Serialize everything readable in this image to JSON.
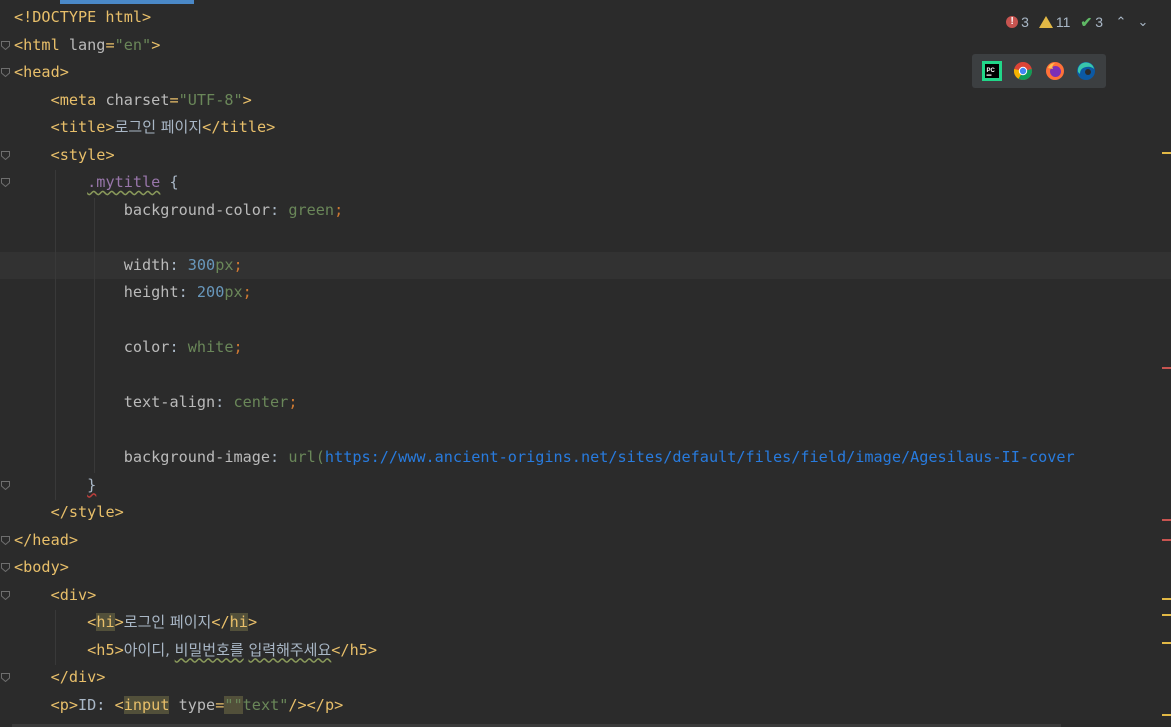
{
  "editor": {
    "lines": [
      {
        "segments": [
          [
            "tag",
            "<!DOCTYPE html>"
          ]
        ],
        "fold": false
      },
      {
        "segments": [
          [
            "tag",
            "<html "
          ],
          [
            "attr",
            "lang"
          ],
          [
            "tag",
            "="
          ],
          [
            "str",
            "\"en\""
          ],
          [
            "tag",
            ">"
          ]
        ],
        "fold": true
      },
      {
        "segments": [
          [
            "tag",
            "<head>"
          ]
        ],
        "fold": true
      },
      {
        "segments": [
          [
            "pl",
            "    "
          ],
          [
            "tag",
            "<meta "
          ],
          [
            "attr",
            "charset"
          ],
          [
            "tag",
            "="
          ],
          [
            "str",
            "\"UTF-8\""
          ],
          [
            "tag",
            ">"
          ]
        ],
        "fold": false
      },
      {
        "segments": [
          [
            "pl",
            "    "
          ],
          [
            "tag",
            "<title>"
          ],
          [
            "kr",
            "로그인 페이지"
          ],
          [
            "tag",
            "</title>"
          ]
        ],
        "fold": false
      },
      {
        "segments": [
          [
            "pl",
            "    "
          ],
          [
            "tag",
            "<style>"
          ]
        ],
        "fold": true
      },
      {
        "segments": [
          [
            "pl",
            "        "
          ],
          [
            "sel-squig",
            ".mytitle"
          ],
          [
            "pl",
            " {"
          ]
        ],
        "fold": true
      },
      {
        "segments": [
          [
            "pl",
            "            "
          ],
          [
            "prop",
            "background-color"
          ],
          [
            "pl",
            ": "
          ],
          [
            "str",
            "green"
          ],
          [
            "kw",
            ";"
          ]
        ],
        "fold": false
      },
      {
        "segments": [
          [
            "pl",
            ""
          ]
        ],
        "fold": false
      },
      {
        "segments": [
          [
            "pl",
            "            "
          ],
          [
            "prop",
            "width"
          ],
          [
            "pl",
            ": "
          ],
          [
            "num",
            "300"
          ],
          [
            "str",
            "px"
          ],
          [
            "kw",
            ";"
          ]
        ],
        "fold": false,
        "current": true
      },
      {
        "segments": [
          [
            "pl",
            "            "
          ],
          [
            "prop",
            "height"
          ],
          [
            "pl",
            ": "
          ],
          [
            "num",
            "200"
          ],
          [
            "str",
            "px"
          ],
          [
            "kw",
            ";"
          ]
        ],
        "fold": false
      },
      {
        "segments": [
          [
            "pl",
            ""
          ]
        ],
        "fold": false
      },
      {
        "segments": [
          [
            "pl",
            "            "
          ],
          [
            "prop",
            "color"
          ],
          [
            "pl",
            ": "
          ],
          [
            "str",
            "white"
          ],
          [
            "kw",
            ";"
          ]
        ],
        "fold": false
      },
      {
        "segments": [
          [
            "pl",
            ""
          ]
        ],
        "fold": false
      },
      {
        "segments": [
          [
            "pl",
            "            "
          ],
          [
            "prop",
            "text-align"
          ],
          [
            "pl",
            ": "
          ],
          [
            "str",
            "center"
          ],
          [
            "kw",
            ";"
          ]
        ],
        "fold": false
      },
      {
        "segments": [
          [
            "pl",
            ""
          ]
        ],
        "fold": false
      },
      {
        "segments": [
          [
            "pl",
            "            "
          ],
          [
            "prop",
            "background-image"
          ],
          [
            "pl",
            ": "
          ],
          [
            "str",
            "url("
          ],
          [
            "url",
            "https://www.ancient-origins.net/sites/default/files/field/image/Agesilaus-II-cover"
          ]
        ],
        "fold": false
      },
      {
        "segments": [
          [
            "pl",
            "        "
          ],
          [
            "red-squig",
            "}"
          ]
        ],
        "fold": true
      },
      {
        "segments": [
          [
            "pl",
            "    "
          ],
          [
            "tag",
            "</style>"
          ]
        ],
        "fold": false
      },
      {
        "segments": [
          [
            "tag",
            "</head>"
          ]
        ],
        "fold": true
      },
      {
        "segments": [
          [
            "tag",
            "<body>"
          ]
        ],
        "fold": true
      },
      {
        "segments": [
          [
            "pl",
            "    "
          ],
          [
            "tag",
            "<div>"
          ]
        ],
        "fold": true
      },
      {
        "segments": [
          [
            "pl",
            "        "
          ],
          [
            "tag",
            "<"
          ],
          [
            "tag-hl",
            "hi"
          ],
          [
            "tag",
            ">"
          ],
          [
            "kr",
            "로그인 페이지"
          ],
          [
            "tag",
            "</"
          ],
          [
            "tag-hl",
            "hi"
          ],
          [
            "tag",
            ">"
          ]
        ],
        "fold": false
      },
      {
        "segments": [
          [
            "pl",
            "        "
          ],
          [
            "tag",
            "<h5>"
          ],
          [
            "kr",
            "아이디, "
          ],
          [
            "kr-squig",
            "비밀번호를"
          ],
          [
            "kr",
            " "
          ],
          [
            "kr-squig",
            "입력해주세요"
          ],
          [
            "tag",
            "</h5>"
          ]
        ],
        "fold": false
      },
      {
        "segments": [
          [
            "pl",
            "    "
          ],
          [
            "tag",
            "</div>"
          ]
        ],
        "fold": true
      },
      {
        "segments": [
          [
            "pl",
            "    "
          ],
          [
            "tag",
            "<p>"
          ],
          [
            "pl",
            "ID: "
          ],
          [
            "tag",
            "<"
          ],
          [
            "tag-hl",
            "input"
          ],
          [
            "pl",
            " "
          ],
          [
            "attr",
            "type"
          ],
          [
            "tag",
            "="
          ],
          [
            "str-hl",
            "\"\""
          ],
          [
            "str",
            "text\""
          ],
          [
            "tag",
            "/></p>"
          ]
        ],
        "fold": false
      }
    ]
  },
  "inspections": {
    "errors": "3",
    "warnings": "11",
    "ok": "3",
    "up_icon": "chevron-up-icon",
    "down_icon": "chevron-down-icon"
  },
  "browsers": [
    {
      "name": "pycharm-icon",
      "label": "PC"
    },
    {
      "name": "chrome-icon",
      "label": ""
    },
    {
      "name": "firefox-icon",
      "label": ""
    },
    {
      "name": "edge-icon",
      "label": ""
    }
  ],
  "colors": {
    "background": "#2b2b2b",
    "tag": "#e8bf6a",
    "string": "#6a8759",
    "number": "#6897bb",
    "url": "#287bde",
    "error": "#c75450",
    "warning": "#e2b845"
  }
}
